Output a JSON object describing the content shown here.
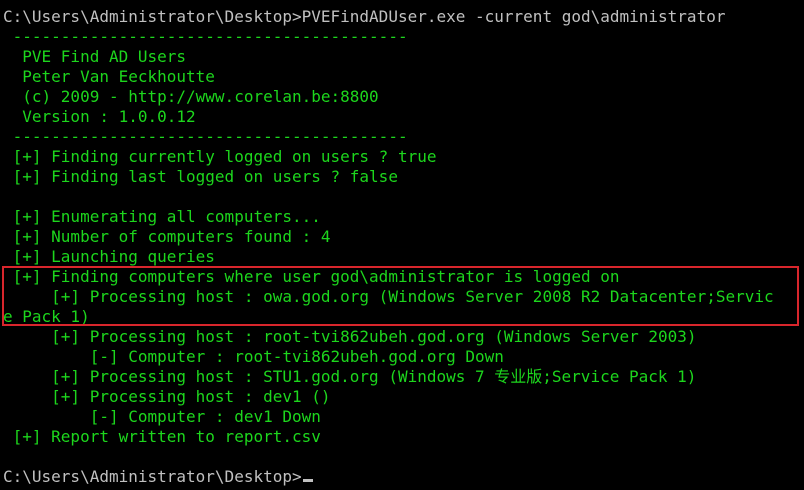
{
  "terminal": {
    "command_line": "C:\\Users\\Administrator\\Desktop>PVEFindADUser.exe -current god\\administrator",
    "separator_top": " -----------------------------------------",
    "banner": [
      "  PVE Find AD Users",
      "  Peter Van Eeckhoutte",
      "  (c) 2009 - http://www.corelan.be:8800",
      "  Version : 1.0.0.12"
    ],
    "separator_bottom": " -----------------------------------------",
    "status_lines": [
      " [+] Finding currently logged on users ? true",
      " [+] Finding last logged on users ? false",
      "",
      " [+] Enumerating all computers...",
      " [+] Number of computers found : 4",
      " [+] Launching queries"
    ],
    "highlighted_lines": [
      " [+] Finding computers where user god\\administrator is logged on",
      "     [+] Processing host : owa.god.org (Windows Server 2008 R2 Datacenter;Servic",
      "e Pack 1)"
    ],
    "result_lines": [
      "     [+] Processing host : root-tvi862ubeh.god.org (Windows Server 2003)",
      "         [-] Computer : root-tvi862ubeh.god.org Down",
      "     [+] Processing host : STU1.god.org (Windows 7 专业版;Service Pack 1)",
      "     [+] Processing host : dev1 ()",
      "         [-] Computer : dev1 Down",
      " [+] Report written to report.csv",
      ""
    ],
    "final_prompt": "C:\\Users\\Administrator\\Desktop>"
  },
  "colors": {
    "background": "#000000",
    "text_green": "#1dd61d",
    "prompt_gray": "#c0c0c0",
    "highlight_red": "#d9262c"
  }
}
